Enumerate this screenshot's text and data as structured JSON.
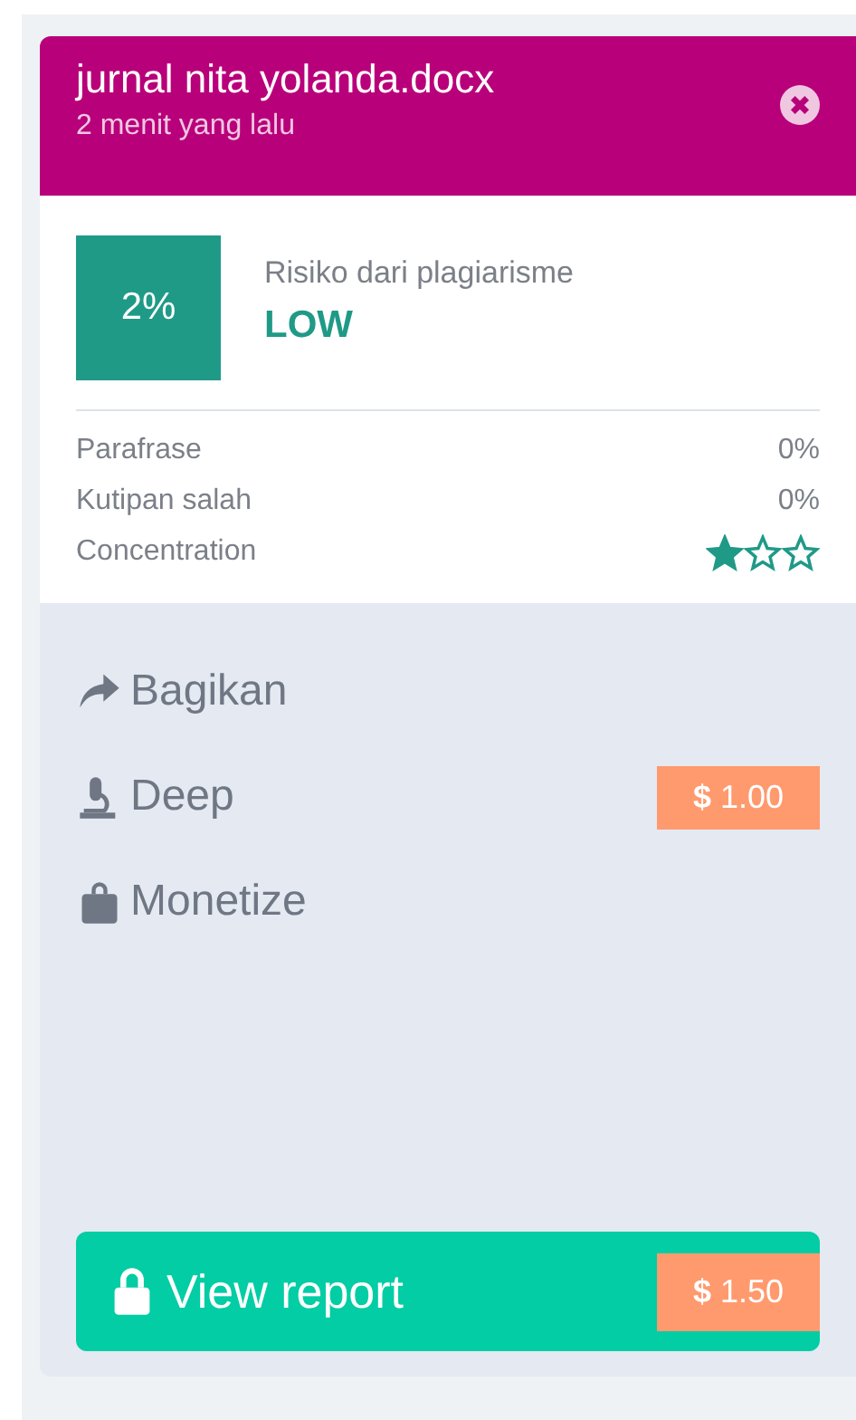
{
  "document": {
    "title": "jurnal nita yolanda.docx",
    "time": "2 menit yang lalu"
  },
  "risk": {
    "percent": "2%",
    "label": "Risiko dari plagiarisme",
    "level_text": "LOW"
  },
  "metrics": [
    {
      "kind": "text",
      "label": "Parafrase",
      "value": "0%"
    },
    {
      "kind": "text",
      "label": "Kutipan salah",
      "value": "0%"
    },
    {
      "kind": "stars",
      "label": "Concentration",
      "stars": 1
    }
  ],
  "actions": [
    {
      "kind": "share",
      "label": "Bagikan"
    },
    {
      "kind": "microscope",
      "label": "Deep",
      "price": "**$** 1.00"
    },
    {
      "kind": "bag",
      "label": "Monetize"
    }
  ],
  "report_button": {
    "label": "View report",
    "price": "**$** 1.50"
  }
}
